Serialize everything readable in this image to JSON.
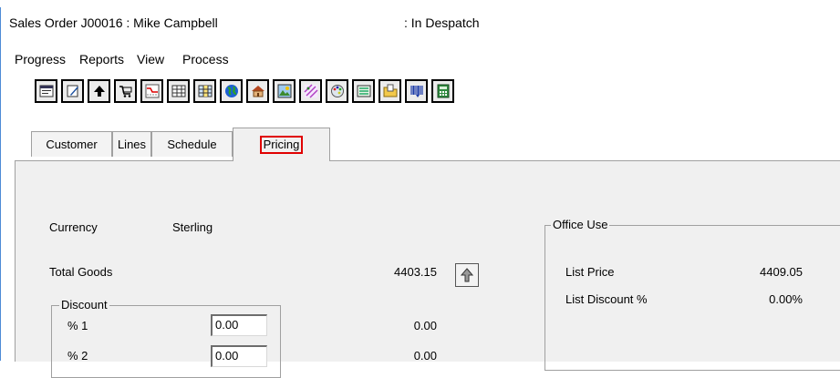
{
  "window": {
    "title": "Sales Order J00016  : Mike Campbell",
    "status": ": In Despatch"
  },
  "menu": {
    "items": [
      "Progress",
      "Reports",
      "View",
      "Process"
    ]
  },
  "toolbar": {
    "icons": [
      "properties-icon",
      "edit-icon",
      "up-arrow-icon",
      "cart-icon",
      "chart-icon",
      "grid-icon",
      "grid-color-icon",
      "globe-icon",
      "house-icon",
      "image-icon",
      "pattern-icon",
      "palette-icon",
      "list-icon",
      "folder-icon",
      "barcode-icon",
      "calculator-icon"
    ]
  },
  "tabs": {
    "items": [
      "Customer",
      "Lines",
      "Schedule",
      "Pricing"
    ],
    "active": "Pricing",
    "highlight_color": "#e00000"
  },
  "pricing": {
    "currency_label": "Currency",
    "currency_value": "Sterling",
    "total_goods_label": "Total Goods",
    "total_goods_value": "4403.15",
    "discount": {
      "legend": "Discount",
      "rows": [
        {
          "label": "% 1",
          "input": "0.00",
          "value": "0.00"
        },
        {
          "label": "% 2",
          "input": "0.00",
          "value": "0.00"
        }
      ]
    }
  },
  "office_use": {
    "legend": "Office Use",
    "list_price_label": "List Price",
    "list_price_value": "4409.05",
    "list_discount_label": "List Discount %",
    "list_discount_value": "0.00%"
  }
}
